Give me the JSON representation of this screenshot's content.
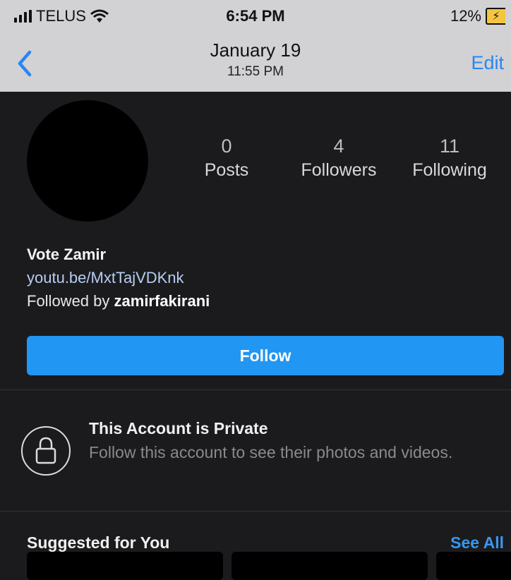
{
  "status_bar": {
    "carrier": "TELUS",
    "time": "6:54 PM",
    "battery": "12%",
    "battery_color": "#f4c542"
  },
  "nav": {
    "date": "January 19",
    "time": "11:55 PM",
    "edit": "Edit",
    "back_icon": "chevron-left-icon"
  },
  "profile": {
    "stats": [
      {
        "value": "0",
        "label": "Posts"
      },
      {
        "value": "4",
        "label": "Followers"
      },
      {
        "value": "11",
        "label": "Following"
      }
    ],
    "name": "Vote Zamir",
    "link": "youtu.be/MxtTajVDKnk",
    "followed_by_prefix": "Followed by ",
    "followed_by_user": "zamirfakirani",
    "follow_button": "Follow"
  },
  "private_notice": {
    "icon": "lock-icon",
    "title": "This Account is Private",
    "subtitle": "Follow this account to see their photos and videos."
  },
  "suggested": {
    "title": "Suggested for You",
    "see_all": "See All"
  },
  "colors": {
    "accent": "#2196f3",
    "link": "#3797f0",
    "background": "#1b1b1d"
  }
}
